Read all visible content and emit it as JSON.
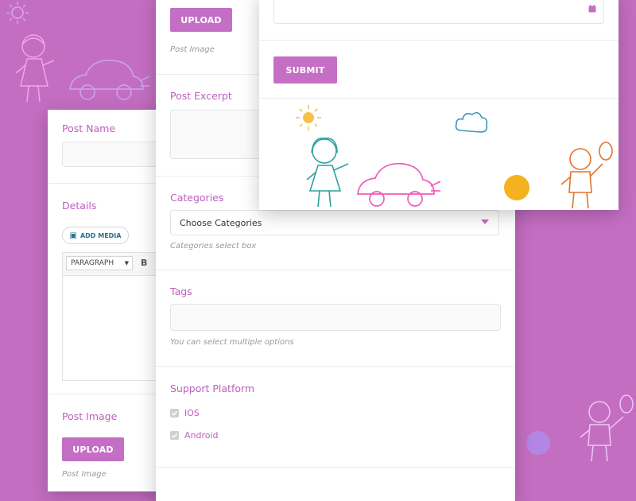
{
  "panel_left": {
    "post_name_label": "Post Name",
    "details_label": "Details",
    "add_media_label": "ADD MEDIA",
    "format_select_value": "PARAGRAPH",
    "bold_label": "B",
    "post_image_label": "Post Image",
    "upload_label": "UPLOAD",
    "post_image_hint": "Post Image"
  },
  "panel_middle": {
    "upload_label": "UPLOAD",
    "post_image_hint": "Post Image",
    "post_excerpt_label": "Post Excerpt",
    "categories_label": "Categories",
    "categories_select_value": "Choose Categories",
    "categories_hint": "Categories select box",
    "tags_label": "Tags",
    "tags_hint": "You can select multiple options",
    "support_platform_label": "Support Platform",
    "platforms": [
      {
        "label": "IOS",
        "checked": true
      },
      {
        "label": "Android",
        "checked": true
      }
    ]
  },
  "panel_right": {
    "submit_label": "SUBMIT",
    "date_icon": "calendar-icon"
  },
  "colors": {
    "background": "#c46ec2",
    "accent": "#c56ec5",
    "label": "#bd5fbf"
  }
}
